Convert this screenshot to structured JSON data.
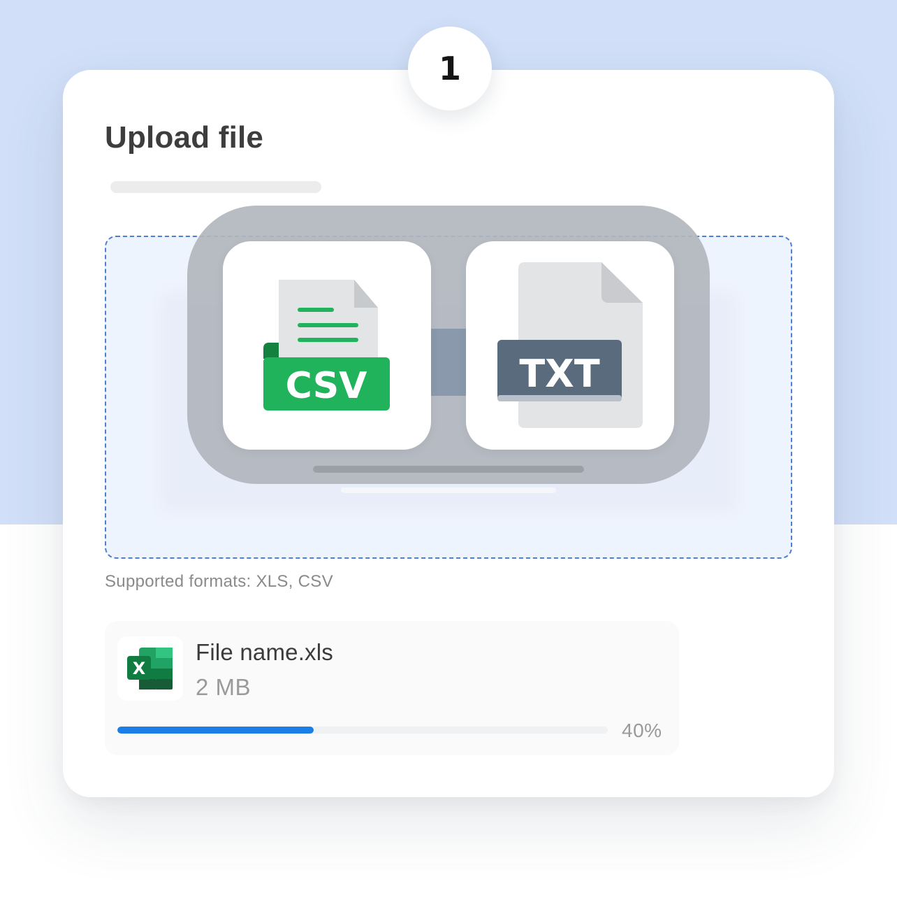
{
  "step": {
    "number": "1"
  },
  "upload": {
    "title": "Upload file",
    "supported_formats": "Supported formats: XLS, CSV"
  },
  "illustration": {
    "csv_label": "CSV",
    "txt_label": "TXT"
  },
  "file": {
    "name": "File name.xls",
    "size": "2 MB",
    "icon": "excel-icon",
    "progress_percent": 40,
    "progress_label": "40%"
  },
  "colors": {
    "page_top_bg": "#d1dff8",
    "accent": "#1a7ee6",
    "csv_green": "#21b35b",
    "txt_slate": "#5a6b7e",
    "excel_green": "#1d7a45",
    "dropzone_border": "#4d7fd6"
  }
}
